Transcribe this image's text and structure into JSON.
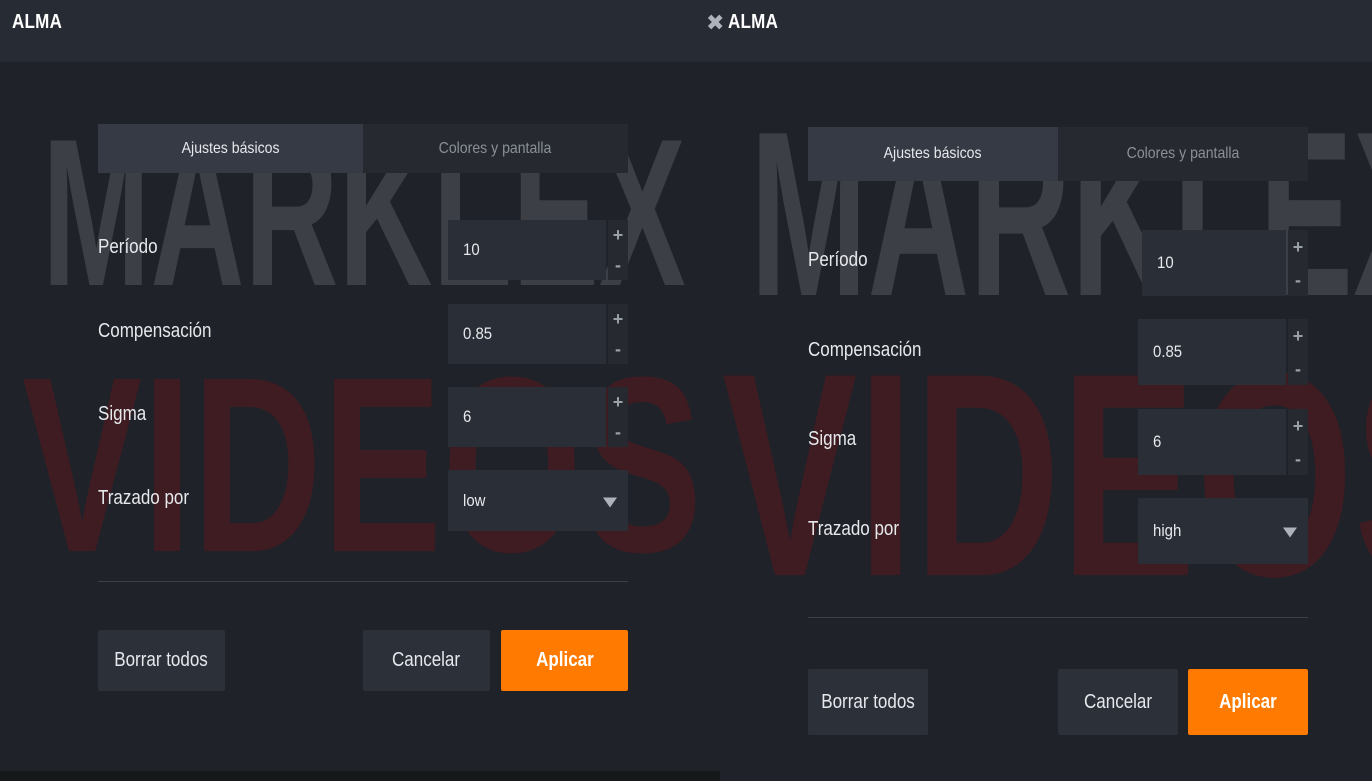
{
  "colors": {
    "background": "#1f2228",
    "titlebar": "#272b34",
    "accent": "#ff7a00",
    "watermark_top": "#5f6168",
    "watermark_bottom": "#69161a"
  },
  "left": {
    "title": "ALMA",
    "watermark": {
      "line1": "MARKLEX",
      "line2": "VIDEOS"
    },
    "tabs": [
      {
        "label": "Ajustes básicos",
        "active": true
      },
      {
        "label": "Colores y pantalla",
        "active": false
      }
    ],
    "fields": {
      "periodo": {
        "label": "Período",
        "value": "10"
      },
      "compensacion": {
        "label": "Compensación",
        "value": "0.85"
      },
      "sigma": {
        "label": "Sigma",
        "value": "6"
      },
      "trazado": {
        "label": "Trazado por",
        "value": "low"
      }
    },
    "stepper": {
      "plus": "+",
      "minus": "-"
    },
    "buttons": {
      "clear": "Borrar todos",
      "cancel": "Cancelar",
      "apply": "Aplicar"
    }
  },
  "right": {
    "title": "ALMA",
    "close_icon": "close-icon",
    "close_glyph": "✖",
    "watermark": {
      "line1": "MARKLEX",
      "line2": "VIDEOS"
    },
    "tabs": [
      {
        "label": "Ajustes básicos",
        "active": true
      },
      {
        "label": "Colores y pantalla",
        "active": false
      }
    ],
    "fields": {
      "periodo": {
        "label": "Período",
        "value": "10"
      },
      "compensacion": {
        "label": "Compensación",
        "value": "0.85"
      },
      "sigma": {
        "label": "Sigma",
        "value": "6"
      },
      "trazado": {
        "label": "Trazado por",
        "value": "high"
      }
    },
    "stepper": {
      "plus": "+",
      "minus": "-"
    },
    "buttons": {
      "clear": "Borrar todos",
      "cancel": "Cancelar",
      "apply": "Aplicar"
    }
  }
}
